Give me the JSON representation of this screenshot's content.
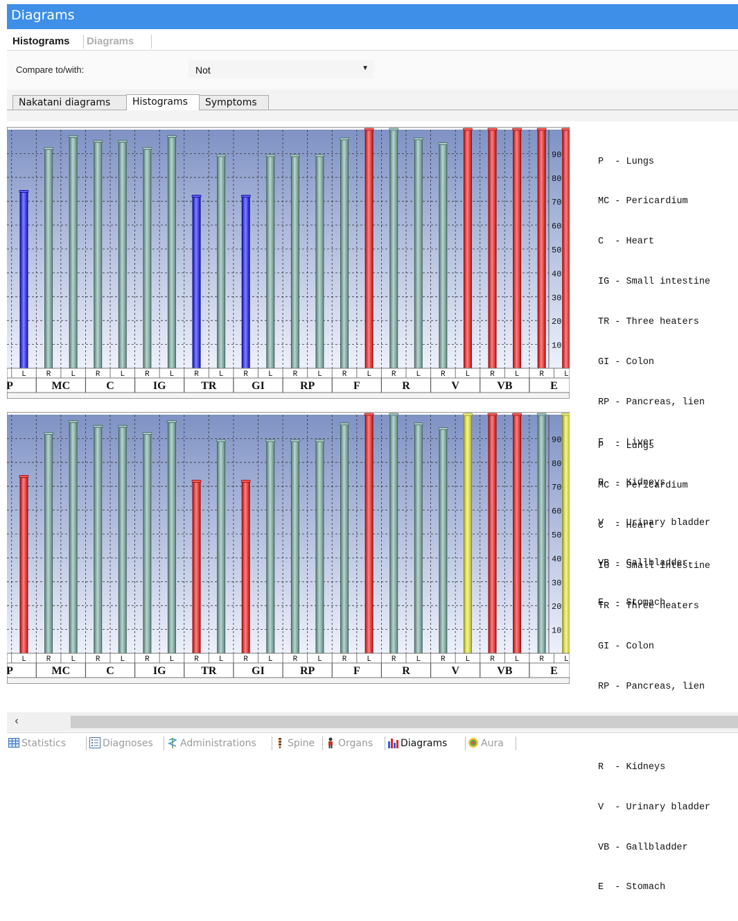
{
  "window": {
    "title": "Diagrams"
  },
  "top_tabs": [
    {
      "label": "Histograms",
      "active": true
    },
    {
      "label": "Diagrams",
      "active": false
    }
  ],
  "compare": {
    "label": "Compare to/with:",
    "value": "Not"
  },
  "sub_tabs": [
    {
      "label": "Nakatani diagrams",
      "active": false
    },
    {
      "label": "Histograms",
      "active": true
    },
    {
      "label": "Symptoms",
      "active": false
    }
  ],
  "legend": [
    "P  - Lungs",
    "MC - Pericardium",
    "C  - Heart",
    "IG - Small intestine",
    "TR - Three heaters",
    "GI - Colon",
    "RP - Pancreas, lien",
    "F  - Liver",
    "R  - Kidneys",
    "V  - Urinary bladder",
    "VB - Gallbladder",
    "E  - Stomach"
  ],
  "colors": {
    "normal": "#7fb5aa",
    "low": "#1a1aff",
    "high": "#ff1a1a",
    "warning": "#f2f23a",
    "plot_top": "#7f92c4",
    "plot_bottom": "#eef1fb"
  },
  "chart_data": [
    {
      "type": "bar",
      "categories": [
        "P",
        "MC",
        "C",
        "IG",
        "TR",
        "GI",
        "RP",
        "F",
        "R",
        "V",
        "VB",
        "E"
      ],
      "sides": [
        "L",
        "R",
        "L",
        "R",
        "L",
        "R",
        "L",
        "R",
        "L",
        "R",
        "L",
        "R",
        "L",
        "R",
        "L",
        "R",
        "L",
        "R",
        "L",
        "R",
        "L",
        "R",
        "L",
        "R",
        "L"
      ],
      "values": [
        74,
        92,
        97,
        95,
        95,
        92,
        97,
        72,
        89,
        72,
        89,
        89,
        89,
        96,
        100,
        100,
        96,
        94,
        100,
        100,
        100,
        100,
        100
      ],
      "status": [
        "low",
        "normal",
        "normal",
        "normal",
        "normal",
        "normal",
        "normal",
        "low",
        "normal",
        "low",
        "normal",
        "normal",
        "normal",
        "normal",
        "high",
        "normal",
        "normal",
        "normal",
        "high",
        "high",
        "high",
        "high",
        "high"
      ],
      "yticks": [
        10,
        20,
        30,
        40,
        50,
        60,
        70,
        80,
        90
      ],
      "ylim": [
        0,
        100
      ],
      "grid": true
    },
    {
      "type": "bar",
      "categories": [
        "P",
        "MC",
        "C",
        "IG",
        "TR",
        "GI",
        "RP",
        "F",
        "R",
        "V",
        "VB",
        "E"
      ],
      "sides": [
        "L",
        "R",
        "L",
        "R",
        "L",
        "R",
        "L",
        "R",
        "L",
        "R",
        "L",
        "R",
        "L",
        "R",
        "L",
        "R",
        "L",
        "R",
        "L",
        "R",
        "L",
        "R",
        "L",
        "R",
        "L"
      ],
      "values": [
        74,
        92,
        97,
        95,
        95,
        92,
        97,
        72,
        89,
        72,
        89,
        89,
        89,
        96,
        100,
        100,
        96,
        94,
        100,
        100,
        100,
        100,
        100
      ],
      "status": [
        "high",
        "normal",
        "normal",
        "normal",
        "normal",
        "normal",
        "normal",
        "high",
        "normal",
        "high",
        "normal",
        "normal",
        "normal",
        "normal",
        "high",
        "normal",
        "normal",
        "normal",
        "warning",
        "high",
        "high",
        "normal",
        "warning"
      ],
      "yticks": [
        10,
        20,
        30,
        40,
        50,
        60,
        70,
        80,
        90
      ],
      "ylim": [
        0,
        100
      ],
      "grid": true
    }
  ],
  "bottom_tabs": [
    {
      "label": "Statistics",
      "icon": "table-icon",
      "active": false
    },
    {
      "label": "Diagnoses",
      "icon": "list-icon",
      "active": false
    },
    {
      "label": "Administrations",
      "icon": "caduceus-icon",
      "active": false
    },
    {
      "label": "Spine",
      "icon": "spine-icon",
      "active": false
    },
    {
      "label": "Organs",
      "icon": "body-icon",
      "active": false
    },
    {
      "label": "Diagrams",
      "icon": "bar-chart-icon",
      "active": true
    },
    {
      "label": "Aura",
      "icon": "aura-icon",
      "active": false
    }
  ]
}
